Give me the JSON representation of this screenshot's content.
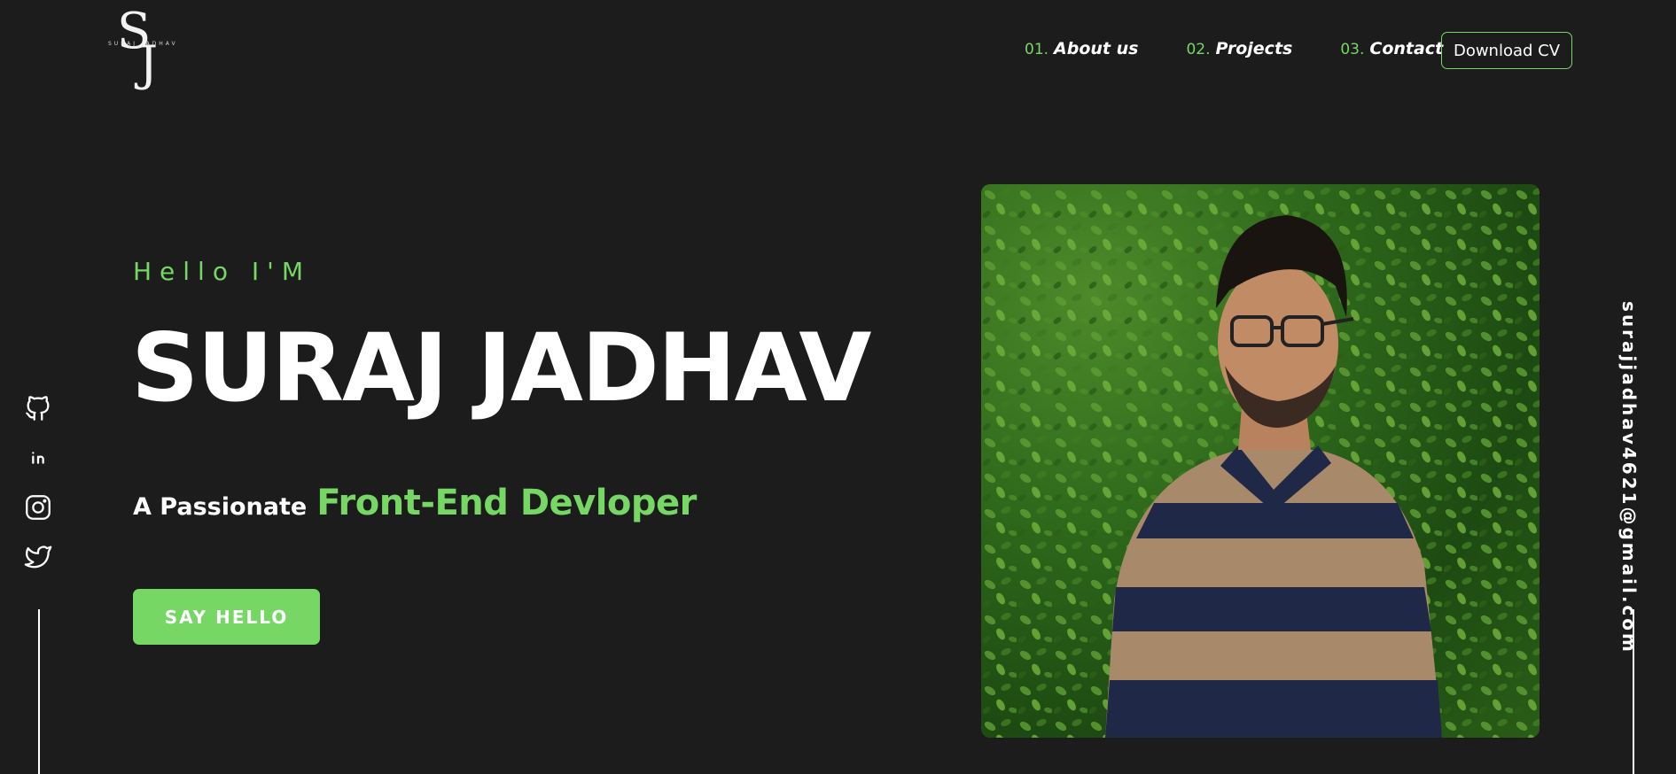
{
  "logo": {
    "monogram_s": "S",
    "monogram_j": "J",
    "tiny_text": "SURAJ JADHAV"
  },
  "nav": {
    "items": [
      {
        "num": "01.",
        "label": "About us"
      },
      {
        "num": "02.",
        "label": "Projects"
      },
      {
        "num": "03.",
        "label": "Contact"
      }
    ],
    "cv_button": "Download CV"
  },
  "hero": {
    "greeting": "Hello I'M",
    "name": "SURAJ JADHAV",
    "tagline_prefix": "A Passionate",
    "tagline_role": "Front-End Devloper",
    "cta": "SAY HELLO"
  },
  "social": [
    "github-icon",
    "linkedin-icon",
    "instagram-icon",
    "twitter-icon"
  ],
  "email": "surajjadhav4621@gmail.com",
  "colors": {
    "background": "#1c1c1c",
    "accent": "#76d765",
    "text": "#ffffff"
  }
}
